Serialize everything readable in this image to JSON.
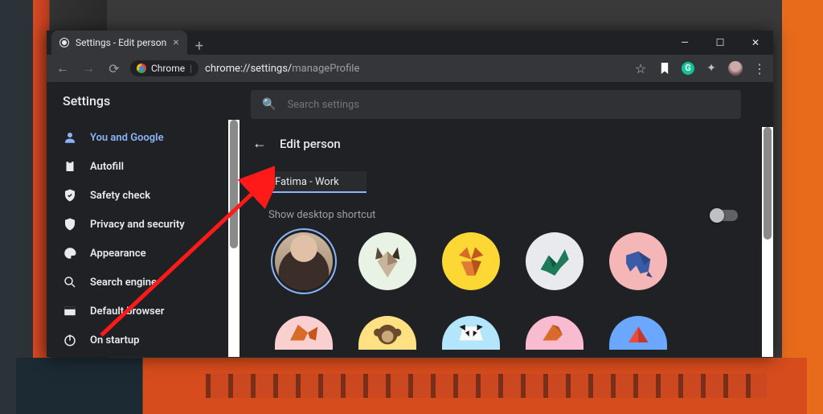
{
  "tab": {
    "title": "Settings - Edit person"
  },
  "url": {
    "scheme_label": "Chrome",
    "path_bold": "chrome://settings/",
    "path_rest": "manageProfile"
  },
  "header": {
    "settings_title": "Settings"
  },
  "search": {
    "placeholder": "Search settings"
  },
  "sidebar": {
    "items": [
      {
        "label": "You and Google"
      },
      {
        "label": "Autofill"
      },
      {
        "label": "Safety check"
      },
      {
        "label": "Privacy and security"
      },
      {
        "label": "Appearance"
      },
      {
        "label": "Search engine"
      },
      {
        "label": "Default browser"
      },
      {
        "label": "On startup"
      }
    ]
  },
  "page": {
    "title": "Edit person",
    "profile_name": "Fatima - Work",
    "shortcut_label": "Show desktop shortcut",
    "shortcut_on": false
  },
  "avatars": {
    "row1": [
      "user-photo",
      "origami-cat",
      "origami-fox",
      "origami-dragon",
      "origami-elephant"
    ],
    "row2": [
      "origami-squirrel",
      "origami-monkey",
      "origami-panda",
      "origami-bird",
      "origami-volcano"
    ]
  },
  "colors": {
    "accent": "#8ab4f8"
  },
  "ext": {
    "grammarly_letter": "G"
  }
}
